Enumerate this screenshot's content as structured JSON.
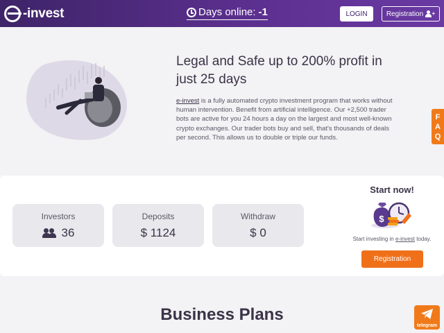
{
  "header": {
    "logo_text": "-invest",
    "days_label": "Days online:",
    "days_value": "-1",
    "login_label": "LOGIN",
    "registration_label": "Registration"
  },
  "hero": {
    "title": "Legal and Safe up to 200% profit in just 25 days",
    "brand": "e-invest",
    "description": " is a fully automated crypto investment program that works without human intervention. Benefit from artificial intelligence. Our +2,500 trader bots are active for you 24 hours a day on the largest and most well-known crypto exchanges. Our trader bots buy and sell, that's thousands of deals per second. This allows us to double or triple our funds."
  },
  "faq": {
    "letters": [
      "F",
      "A",
      "Q"
    ]
  },
  "stats": [
    {
      "label": "Investors",
      "value": "36",
      "icon": "users-icon"
    },
    {
      "label": "Deposits",
      "value": "$ 1124"
    },
    {
      "label": "Withdraw",
      "value": "$ 0"
    }
  ],
  "start": {
    "title": "Start now!",
    "text_before": "Start investing in ",
    "brand": "e-invest",
    "text_after": " today.",
    "button_label": "Registration"
  },
  "business_plans_title": "Business Plans",
  "telegram": {
    "label": "telegram"
  },
  "colors": {
    "header": "#4b2a7a",
    "accent": "#f0701a",
    "background": "#f3f2f4"
  }
}
